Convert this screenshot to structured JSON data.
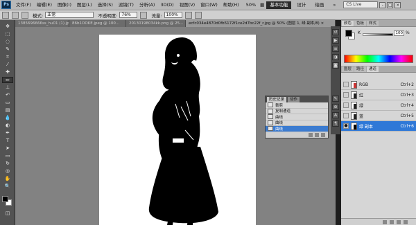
{
  "menubar": {
    "logo": "Ps",
    "items": [
      "文件(F)",
      "编辑(E)",
      "图像(I)",
      "图层(L)",
      "选择(S)",
      "滤镜(T)",
      "分析(A)",
      "3D(D)",
      "视图(V)",
      "窗口(W)",
      "帮助(H)"
    ],
    "zoom": "50%",
    "workspaces": [
      "基本功能",
      "设计",
      "绘画"
    ],
    "more": "»",
    "search_placeholder": "CS Live",
    "window_controls": [
      "-",
      "□",
      "×"
    ]
  },
  "options": {
    "mode_label": "模式:",
    "mode_value": "正常",
    "opacity_label": "不透明度:",
    "opacity_value": "76%",
    "flow_label": "流量:",
    "flow_value": "100%"
  },
  "tabs": [
    {
      "label": "1385696666ss_hu01 (1).jpg @ 10...",
      "active": false
    },
    {
      "label": "86b1OOKE.jpeg @ 100...",
      "active": false
    },
    {
      "label": "20130198034kk.png @ 25...",
      "active": false
    },
    {
      "label": "ecfc034e4870d0fb5172f1ce2d7bc22f_r.jpg @ 50% (图层 1, 绿 副本/8) ×",
      "active": true
    }
  ],
  "history": {
    "tabs": [
      "历史记录",
      "动作"
    ],
    "rows": [
      "裁剪",
      "复制通道",
      "曲线",
      "曲线",
      "曲线"
    ],
    "selected_index": 4
  },
  "color_panel": {
    "tabs": [
      "颜色",
      "色板",
      "样式"
    ],
    "slider_label": "K",
    "slider_value": "100",
    "unit": "%",
    "foreground": "#000000",
    "background": "#ffffff"
  },
  "channels": {
    "tabs": [
      "图层",
      "路径",
      "通道"
    ],
    "active_tab": "通道",
    "rows": [
      {
        "name": "RGB",
        "key": "Ctrl+2",
        "visible": false,
        "selected": false
      },
      {
        "name": "红",
        "key": "Ctrl+3",
        "visible": false,
        "selected": false
      },
      {
        "name": "绿",
        "key": "Ctrl+4",
        "visible": false,
        "selected": false
      },
      {
        "name": "蓝",
        "key": "Ctrl+5",
        "visible": false,
        "selected": false
      },
      {
        "name": "绿 副本",
        "key": "Ctrl+6",
        "visible": true,
        "selected": true
      }
    ]
  },
  "colors": {
    "selection": "#2f78d7",
    "panel_bg": "#d6d6d6",
    "canvas_bg": "#828282"
  }
}
